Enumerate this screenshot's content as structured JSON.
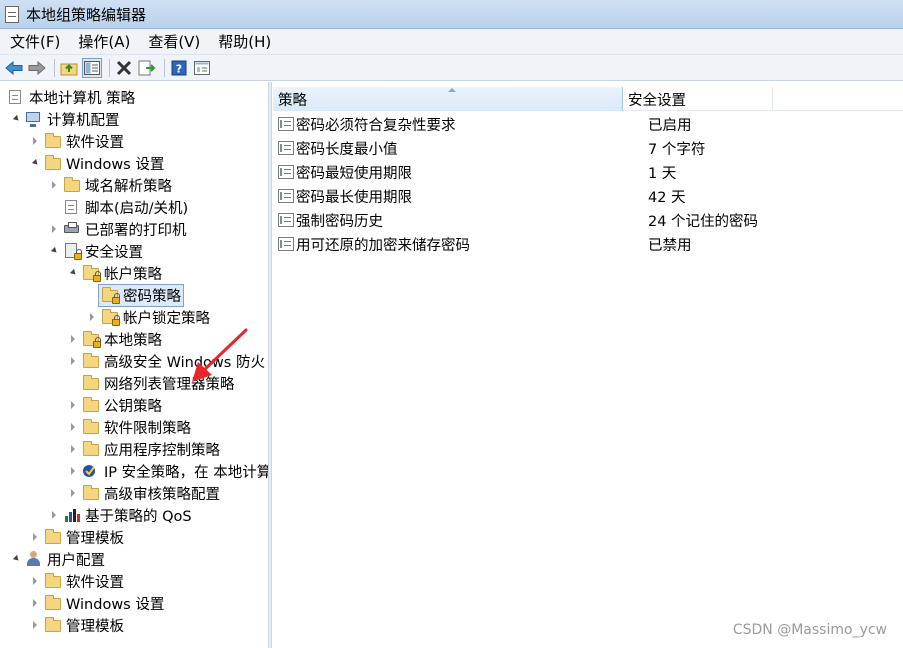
{
  "window": {
    "title": "本地组策略编辑器"
  },
  "menu": {
    "items": [
      "文件(F)",
      "操作(A)",
      "查看(V)",
      "帮助(H)"
    ]
  },
  "toolbar": {
    "icons": [
      "back-arrow-icon",
      "forward-arrow-icon",
      "up-folder-icon",
      "show-hide-tree-icon",
      "delete-icon",
      "export-list-icon",
      "help-icon",
      "properties-icon"
    ]
  },
  "tree": {
    "root": "本地计算机 策略",
    "items": [
      {
        "label": "计算机配置",
        "icon": "computer"
      },
      {
        "label": "软件设置",
        "icon": "folder"
      },
      {
        "label": "Windows 设置",
        "icon": "folder"
      },
      {
        "label": "域名解析策略",
        "icon": "folder"
      },
      {
        "label": "脚本(启动/关机)",
        "icon": "doc"
      },
      {
        "label": "已部署的打印机",
        "icon": "printer"
      },
      {
        "label": "安全设置",
        "icon": "security"
      },
      {
        "label": "帐户策略",
        "icon": "locked-folder"
      },
      {
        "label": "密码策略",
        "icon": "locked-folder",
        "selected": true
      },
      {
        "label": "帐户锁定策略",
        "icon": "locked-folder"
      },
      {
        "label": "本地策略",
        "icon": "locked-folder"
      },
      {
        "label": "高级安全 Windows 防火",
        "icon": "folder"
      },
      {
        "label": "网络列表管理器策略",
        "icon": "folder"
      },
      {
        "label": "公钥策略",
        "icon": "folder"
      },
      {
        "label": "软件限制策略",
        "icon": "folder"
      },
      {
        "label": "应用程序控制策略",
        "icon": "folder"
      },
      {
        "label": "IP 安全策略，在 本地计算",
        "icon": "ip-security"
      },
      {
        "label": "高级审核策略配置",
        "icon": "folder"
      },
      {
        "label": "基于策略的 QoS",
        "icon": "bar-chart"
      },
      {
        "label": "管理模板",
        "icon": "folder"
      },
      {
        "label": "用户配置",
        "icon": "user"
      },
      {
        "label": "软件设置",
        "icon": "folder"
      },
      {
        "label": "Windows 设置",
        "icon": "folder"
      },
      {
        "label": "管理模板",
        "icon": "folder"
      }
    ]
  },
  "list": {
    "columns": [
      "策略",
      "安全设置"
    ],
    "rows": [
      {
        "policy": "密码必须符合复杂性要求",
        "setting": "已启用"
      },
      {
        "policy": "密码长度最小值",
        "setting": "7 个字符"
      },
      {
        "policy": "密码最短使用期限",
        "setting": "1 天"
      },
      {
        "policy": "密码最长使用期限",
        "setting": "42 天"
      },
      {
        "policy": "强制密码历史",
        "setting": "24 个记住的密码"
      },
      {
        "policy": "用可还原的加密来储存密码",
        "setting": "已禁用"
      }
    ]
  },
  "watermark": "CSDN @Massimo_ycw",
  "colors": {
    "annotation_arrow": "#e8262b",
    "selection": "#dbe9f9"
  }
}
